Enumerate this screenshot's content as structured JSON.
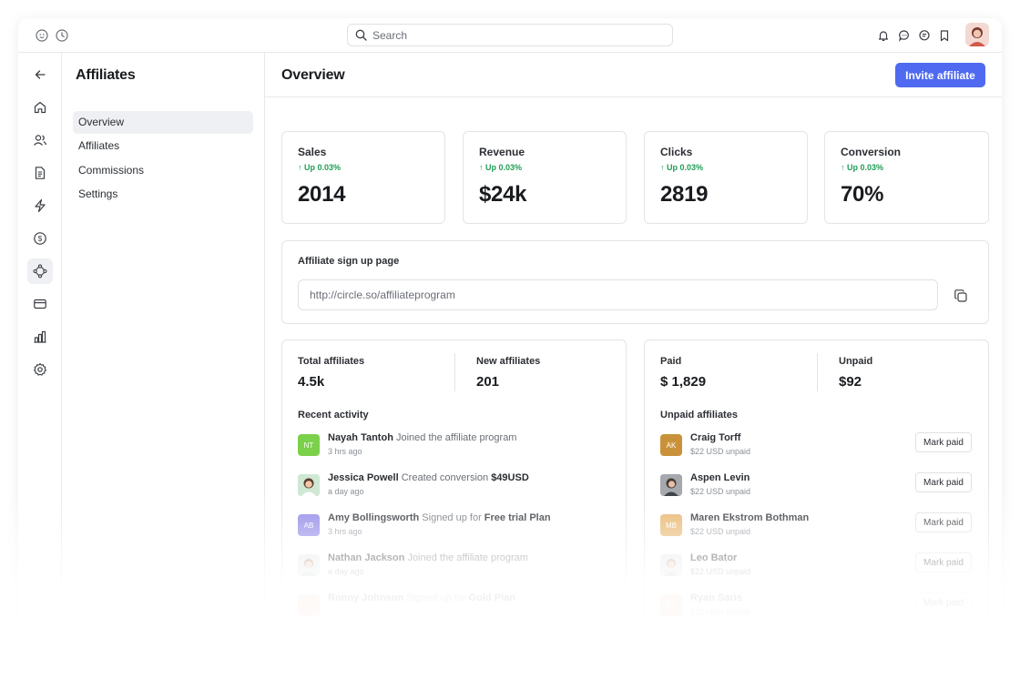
{
  "topbar": {
    "left_icons": [
      "logo-icon",
      "history-icon"
    ],
    "search": {
      "placeholder": "Search"
    },
    "right_icons": [
      "bell-icon",
      "chat-icon",
      "messages-icon",
      "bookmark-icon"
    ]
  },
  "rail": {
    "items": [
      "back-icon",
      "home-icon",
      "users-icon",
      "document-icon",
      "bolt-icon",
      "dollar-icon",
      "affiliates-icon",
      "card-icon",
      "chart-icon",
      "gear-icon"
    ],
    "active": "affiliates-icon"
  },
  "sidenav": {
    "title": "Affiliates",
    "items": [
      {
        "label": "Overview",
        "active": true
      },
      {
        "label": "Affiliates",
        "active": false
      },
      {
        "label": "Commissions",
        "active": false
      },
      {
        "label": "Settings",
        "active": false
      }
    ]
  },
  "main": {
    "title": "Overview",
    "invite_label": "Invite affiliate",
    "stats": [
      {
        "label": "Sales",
        "change": "Up 0.03%",
        "value": "2014"
      },
      {
        "label": "Revenue",
        "change": "Up 0.03%",
        "value": "$24k"
      },
      {
        "label": "Clicks",
        "change": "Up 0.03%",
        "value": "2819"
      },
      {
        "label": "Conversion",
        "change": "Up 0.03%",
        "value": "70%"
      }
    ],
    "signup": {
      "label": "Affiliate sign up page",
      "url": "http://circle.so/affiliateprogram"
    },
    "affiliates_card": {
      "total_label": "Total affiliates",
      "total_value": "4.5k",
      "new_label": "New affiliates",
      "new_value": "201",
      "activity_label": "Recent activity",
      "activity": [
        {
          "initials": "NT",
          "color": "#7bd14a",
          "name": "Nayah Tantoh",
          "action": "Joined the affiliate program",
          "target": "",
          "time": "3 hrs ago"
        },
        {
          "initials": "",
          "color": "#9fd3a8",
          "name": "Jessica Powell",
          "action": "Created conversion",
          "target": "$49USD",
          "time": "a day ago"
        },
        {
          "initials": "AB",
          "color": "#8f86e6",
          "name": "Amy Bollingsworth",
          "action": "Signed up for",
          "target": "Free trial Plan",
          "time": "3 hrs ago"
        },
        {
          "initials": "",
          "color": "#d9dde2",
          "name": "Nathan Jackson",
          "action": "Joined the affiliate program",
          "target": "",
          "time": "a day ago"
        },
        {
          "initials": "",
          "color": "#f2b49a",
          "name": "Ronny Johnson",
          "action": "Signed up for",
          "target": "Gold Plan",
          "time": ""
        }
      ]
    },
    "payouts_card": {
      "paid_label": "Paid",
      "paid_value": "$ 1,829",
      "unpaid_label": "Unpaid",
      "unpaid_value": "$92",
      "list_label": "Unpaid affiliates",
      "mark_label": "Mark paid",
      "affiliates": [
        {
          "initials": "AK",
          "color": "#c9923a",
          "name": "Craig Torff",
          "amount": "$22 USD unpaid"
        },
        {
          "initials": "",
          "color": "#8a8f96",
          "name": "Aspen Levin",
          "amount": "$22 USD unpaid"
        },
        {
          "initials": "MB",
          "color": "#e7b46a",
          "name": "Maren Ekstrom Bothman",
          "amount": "$22 USD unpaid"
        },
        {
          "initials": "",
          "color": "#d9dde2",
          "name": "Leo Bator",
          "amount": "$22 USD unpaid"
        },
        {
          "initials": "RJ",
          "color": "#f2b49a",
          "name": "Ryan Saris",
          "amount": "$22 USD unpaid"
        }
      ]
    }
  },
  "colors": {
    "accent": "#4f6af0",
    "positive": "#1f9d55"
  }
}
